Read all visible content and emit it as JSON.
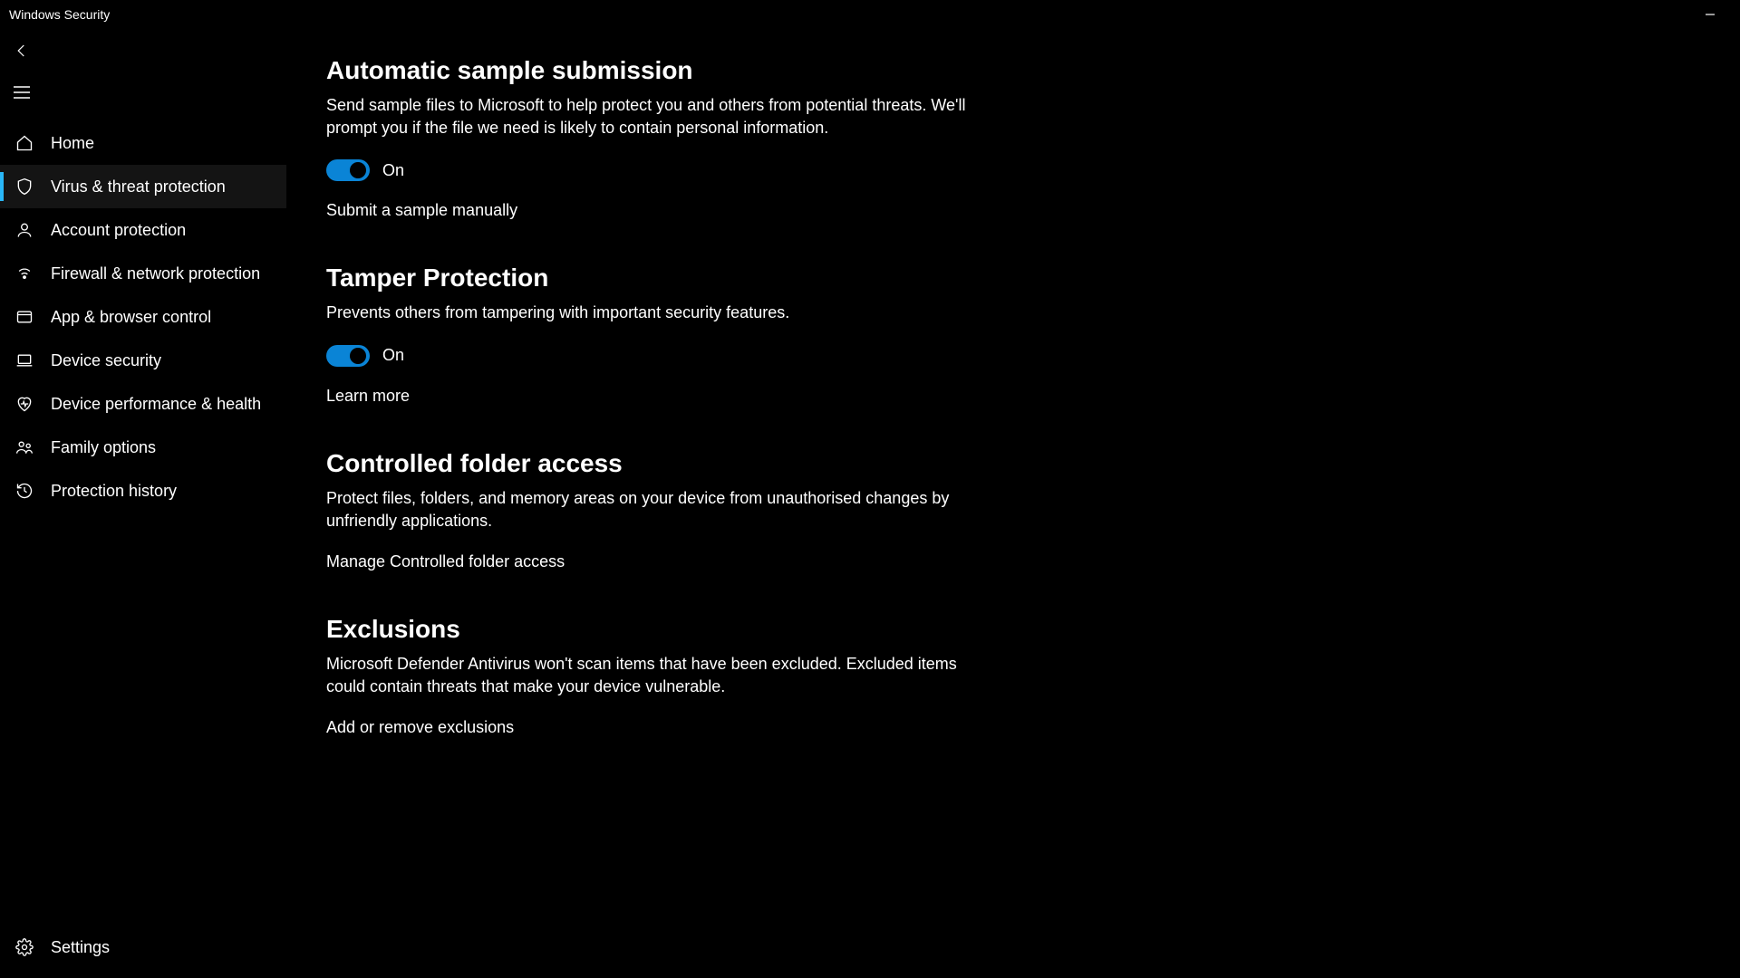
{
  "window": {
    "title": "Windows Security"
  },
  "sidebar": {
    "items": [
      {
        "label": "Home"
      },
      {
        "label": "Virus & threat protection"
      },
      {
        "label": "Account protection"
      },
      {
        "label": "Firewall & network protection"
      },
      {
        "label": "App & browser control"
      },
      {
        "label": "Device security"
      },
      {
        "label": "Device performance & health"
      },
      {
        "label": "Family options"
      },
      {
        "label": "Protection history"
      }
    ],
    "settings_label": "Settings"
  },
  "sections": {
    "auto_sample": {
      "title": "Automatic sample submission",
      "desc": "Send sample files to Microsoft to help protect you and others from potential threats. We'll prompt you if the file we need is likely to contain personal information.",
      "toggle_state": "On",
      "link": "Submit a sample manually"
    },
    "tamper": {
      "title": "Tamper Protection",
      "desc": "Prevents others from tampering with important security features.",
      "toggle_state": "On",
      "link": "Learn more"
    },
    "controlled_folder": {
      "title": "Controlled folder access",
      "desc": "Protect files, folders, and memory areas on your device from unauthorised changes by unfriendly applications.",
      "link": "Manage Controlled folder access"
    },
    "exclusions": {
      "title": "Exclusions",
      "desc": "Microsoft Defender Antivirus won't scan items that have been excluded. Excluded items could contain threats that make your device vulnerable.",
      "link": "Add or remove exclusions"
    }
  }
}
